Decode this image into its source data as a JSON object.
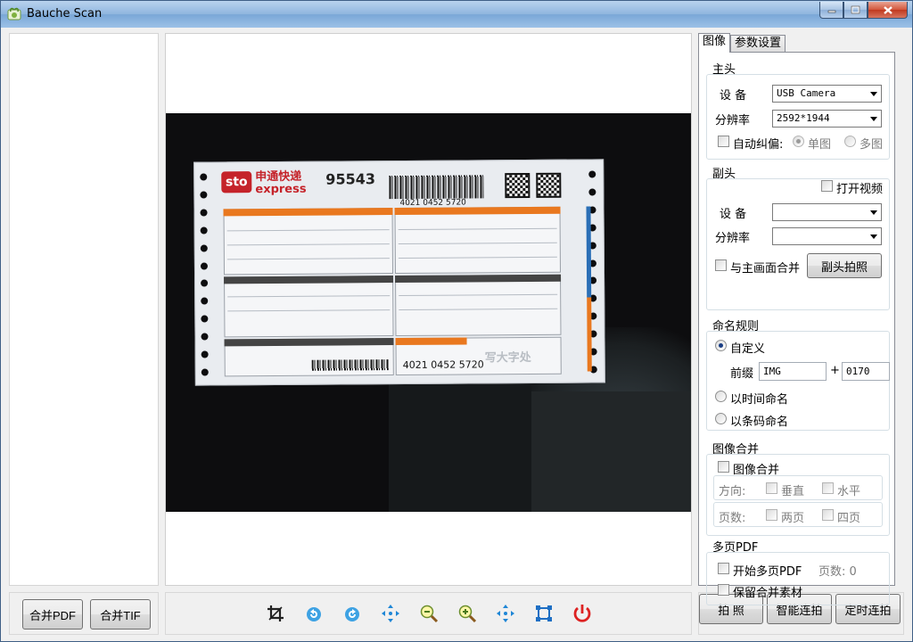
{
  "window": {
    "title": "Bauche Scan"
  },
  "preview": {
    "receipt": {
      "logo": "sto",
      "brand_cn": "申通快递",
      "brand_en": "express",
      "number": "95543",
      "tracking": "4021 0452 5720",
      "stamp": "写大字处"
    }
  },
  "bottom_left": {
    "merge_pdf_label": "合并PDF",
    "merge_tif_label": "合并TIF"
  },
  "toolbar": {
    "tools": [
      "crop-icon",
      "rotate-left-icon",
      "rotate-right-icon",
      "fit-icon",
      "zoom-out-icon",
      "zoom-in-icon",
      "move-icon",
      "fullscreen-icon",
      "power-icon"
    ]
  },
  "bottom_right": {
    "capture_label": "拍 照",
    "smart_burst_label": "智能连拍",
    "timed_burst_label": "定时连拍"
  },
  "tabs": {
    "image": "图像",
    "params": "参数设置"
  },
  "main_camera": {
    "title": "主头",
    "device_label": "设 备",
    "device_value": "USB Camera",
    "resolution_label": "分辨率",
    "resolution_value": "2592*1944",
    "auto_deskew_label": "自动纠偏:",
    "single_label": "单图",
    "multi_label": "多图"
  },
  "sub_camera": {
    "title": "副头",
    "open_video_label": "打开视频",
    "device_label": "设 备",
    "device_value": "",
    "resolution_label": "分辨率",
    "resolution_value": "",
    "merge_label": "与主画面合并",
    "capture_button": "副头拍照"
  },
  "naming": {
    "title": "命名规则",
    "custom_label": "自定义",
    "prefix_label": "前缀",
    "prefix_value": "IMG",
    "plus": "+",
    "counter_value": "0170",
    "time_label": "以时间命名",
    "barcode_label": "以条码命名"
  },
  "image_merge": {
    "title": "图像合并",
    "enable_label": "图像合并",
    "direction_label": "方向:",
    "vertical_label": "垂直",
    "horizontal_label": "水平",
    "pages_label": "页数:",
    "two_label": "两页",
    "four_label": "四页"
  },
  "multipage_pdf": {
    "title": "多页PDF",
    "start_label": "开始多页PDF",
    "pages_text": "页数: 0",
    "keep_label": "保留合并素材"
  }
}
